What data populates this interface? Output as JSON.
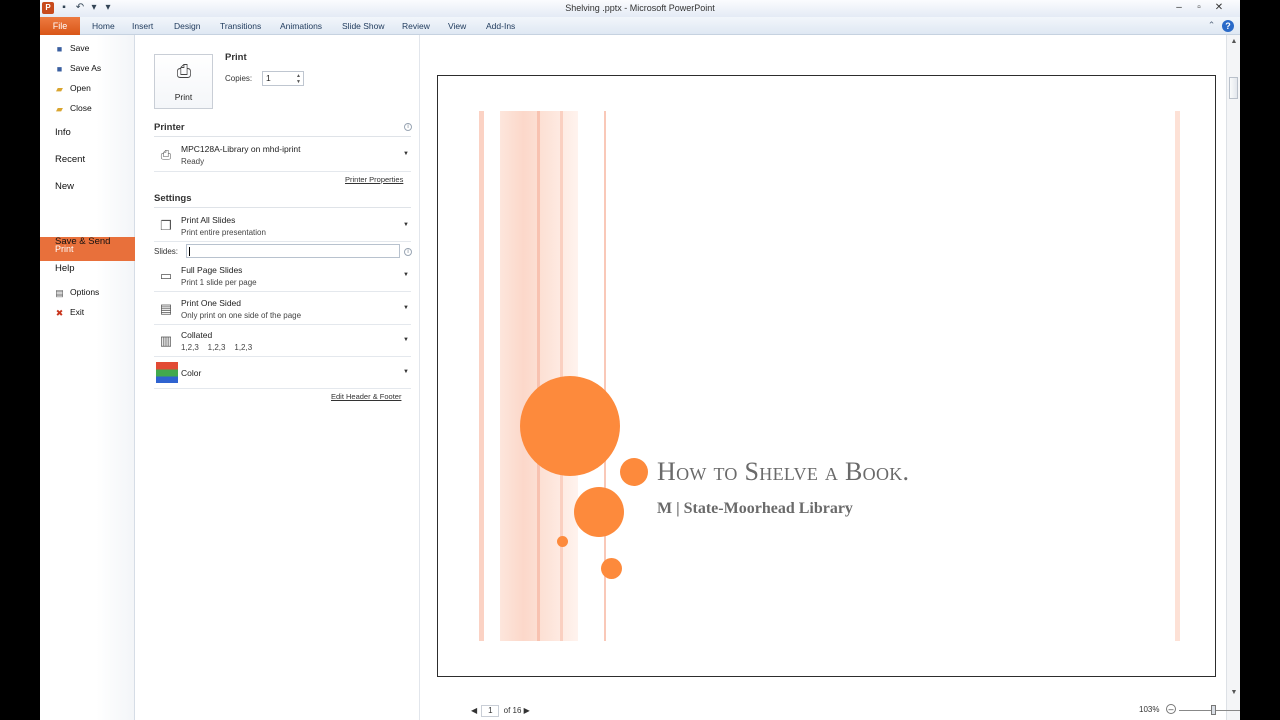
{
  "window": {
    "title": "Shelving .pptx - Microsoft PowerPoint",
    "app_icon_letter": "P"
  },
  "ribbon": {
    "file_tab": "File",
    "tabs": [
      "Home",
      "Insert",
      "Design",
      "Transitions",
      "Animations",
      "Slide Show",
      "Review",
      "View",
      "Add-Ins"
    ]
  },
  "nav": {
    "save": "Save",
    "save_as": "Save As",
    "open": "Open",
    "close": "Close",
    "info": "Info",
    "recent": "Recent",
    "new": "New",
    "print": "Print",
    "save_send": "Save & Send",
    "help": "Help",
    "options": "Options",
    "exit": "Exit"
  },
  "print_panel": {
    "print_heading": "Print",
    "print_button": "Print",
    "copies_label": "Copies:",
    "copies_value": "1",
    "printer_heading": "Printer",
    "printer_name": "MPC128A-Library on mhd-iprint",
    "printer_status": "Ready",
    "printer_properties": "Printer Properties",
    "settings_heading": "Settings",
    "print_range_title": "Print All Slides",
    "print_range_sub": "Print entire presentation",
    "slides_label": "Slides:",
    "layout_title": "Full Page Slides",
    "layout_sub": "Print 1 slide per page",
    "sides_title": "Print One Sided",
    "sides_sub": "Only print on one side of the page",
    "collate_title": "Collated",
    "collate_sub": "1,2,3    1,2,3    1,2,3",
    "color_title": "Color",
    "edit_header_footer": "Edit Header & Footer"
  },
  "preview": {
    "slide_title": "How to Shelve a Book.",
    "slide_subtitle": "M | State-Moorhead Library",
    "page_current": "1",
    "page_total": "of 16",
    "zoom_level": "103%",
    "accent_color": "#fd8a3c"
  }
}
